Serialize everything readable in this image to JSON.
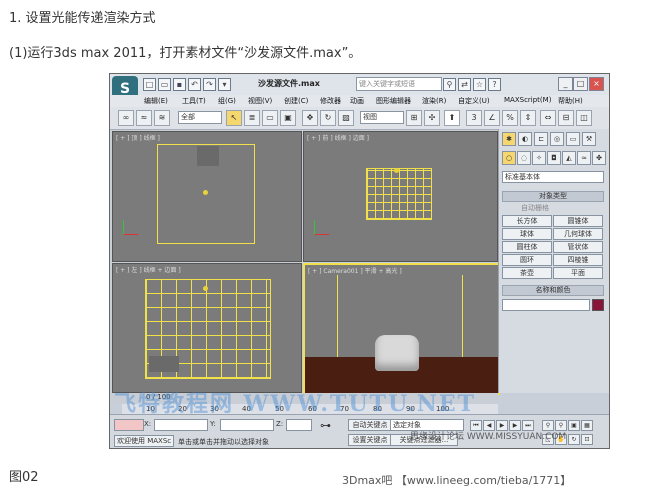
{
  "article": {
    "heading": "1. 设置光能传递渲染方式",
    "step_text": "(1)运行3ds max 2011，打开素材文件“沙发源文件.max”。",
    "figure_caption": "图02",
    "watermark_bottom": "3Dmax吧 【www.lineeg.com/tieba/1771】"
  },
  "app": {
    "doc_title": "沙发源文件.max",
    "search_placeholder": "键入关键字或短语",
    "menu": [
      "编辑(E)",
      "工具(T)",
      "组(G)",
      "视图(V)",
      "创建(C)",
      "修改器",
      "动画",
      "图形编辑器",
      "渲染(R)",
      "自定义(U)",
      "MAXScript(M)",
      "帮助(H)"
    ],
    "toolbar": {
      "filter_value": "全部",
      "refcoord_value": "视图"
    },
    "viewports": {
      "top": "[ + ] 顶 ] 线框 ]",
      "front": "[ + ] 前 ] 线框 ] 边面 ]",
      "left": "[ + ] 左 ] 线框 + 边面 ]",
      "camera": "[ + ] Camera001 ] 平滑 + 高光 ]"
    },
    "command_panel": {
      "category_value": "标准基本体",
      "object_type_header": "对象类型",
      "autogrid_label": "自动栅格",
      "buttons": [
        "长方体",
        "圆锥体",
        "球体",
        "几何球体",
        "圆柱体",
        "管状体",
        "圆环",
        "四棱锥",
        "茶壶",
        "平面"
      ],
      "name_color_header": "名称和颜色"
    },
    "timeline": {
      "frame_counter": "0 / 100",
      "ticks": [
        "10",
        "20",
        "30",
        "40",
        "50",
        "60",
        "70",
        "80",
        "90",
        "100"
      ]
    },
    "status": {
      "welcome": "欢迎使用 MAXSc",
      "prompt": "单击或单击并拖动以选择对象",
      "x_label": "X:",
      "y_label": "Y:",
      "z_label": "Z:",
      "autokey": "自动关键点",
      "setkey": "设置关键点",
      "selected_object": "选定对象",
      "key_filters": "关键点过滤器..."
    },
    "watermark_overlay": "思缘设计论坛  WWW.MISSYUAN.COM",
    "watermark_blue": "飞特教程网 WWW.TUTU.NET"
  },
  "colors": {
    "viewport_bg": "#7b7b7b",
    "wire": "#f0e04a",
    "floor": "#4a1f12"
  }
}
